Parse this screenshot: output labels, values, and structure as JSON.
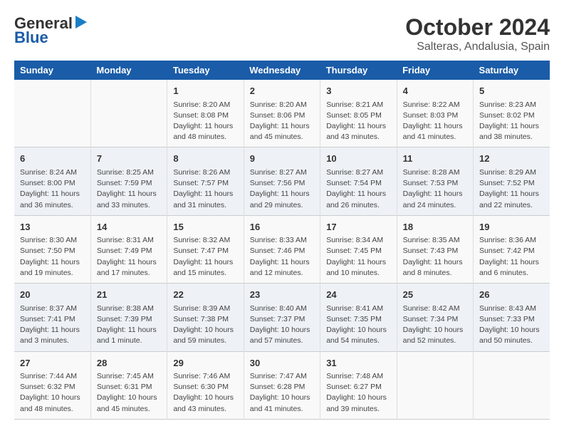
{
  "header": {
    "logo_line1": "General",
    "logo_line2": "Blue",
    "title": "October 2024",
    "subtitle": "Salteras, Andalusia, Spain"
  },
  "calendar": {
    "days_of_week": [
      "Sunday",
      "Monday",
      "Tuesday",
      "Wednesday",
      "Thursday",
      "Friday",
      "Saturday"
    ],
    "weeks": [
      [
        {
          "day": "",
          "info": ""
        },
        {
          "day": "",
          "info": ""
        },
        {
          "day": "1",
          "info": "Sunrise: 8:20 AM\nSunset: 8:08 PM\nDaylight: 11 hours and 48 minutes."
        },
        {
          "day": "2",
          "info": "Sunrise: 8:20 AM\nSunset: 8:06 PM\nDaylight: 11 hours and 45 minutes."
        },
        {
          "day": "3",
          "info": "Sunrise: 8:21 AM\nSunset: 8:05 PM\nDaylight: 11 hours and 43 minutes."
        },
        {
          "day": "4",
          "info": "Sunrise: 8:22 AM\nSunset: 8:03 PM\nDaylight: 11 hours and 41 minutes."
        },
        {
          "day": "5",
          "info": "Sunrise: 8:23 AM\nSunset: 8:02 PM\nDaylight: 11 hours and 38 minutes."
        }
      ],
      [
        {
          "day": "6",
          "info": "Sunrise: 8:24 AM\nSunset: 8:00 PM\nDaylight: 11 hours and 36 minutes."
        },
        {
          "day": "7",
          "info": "Sunrise: 8:25 AM\nSunset: 7:59 PM\nDaylight: 11 hours and 33 minutes."
        },
        {
          "day": "8",
          "info": "Sunrise: 8:26 AM\nSunset: 7:57 PM\nDaylight: 11 hours and 31 minutes."
        },
        {
          "day": "9",
          "info": "Sunrise: 8:27 AM\nSunset: 7:56 PM\nDaylight: 11 hours and 29 minutes."
        },
        {
          "day": "10",
          "info": "Sunrise: 8:27 AM\nSunset: 7:54 PM\nDaylight: 11 hours and 26 minutes."
        },
        {
          "day": "11",
          "info": "Sunrise: 8:28 AM\nSunset: 7:53 PM\nDaylight: 11 hours and 24 minutes."
        },
        {
          "day": "12",
          "info": "Sunrise: 8:29 AM\nSunset: 7:52 PM\nDaylight: 11 hours and 22 minutes."
        }
      ],
      [
        {
          "day": "13",
          "info": "Sunrise: 8:30 AM\nSunset: 7:50 PM\nDaylight: 11 hours and 19 minutes."
        },
        {
          "day": "14",
          "info": "Sunrise: 8:31 AM\nSunset: 7:49 PM\nDaylight: 11 hours and 17 minutes."
        },
        {
          "day": "15",
          "info": "Sunrise: 8:32 AM\nSunset: 7:47 PM\nDaylight: 11 hours and 15 minutes."
        },
        {
          "day": "16",
          "info": "Sunrise: 8:33 AM\nSunset: 7:46 PM\nDaylight: 11 hours and 12 minutes."
        },
        {
          "day": "17",
          "info": "Sunrise: 8:34 AM\nSunset: 7:45 PM\nDaylight: 11 hours and 10 minutes."
        },
        {
          "day": "18",
          "info": "Sunrise: 8:35 AM\nSunset: 7:43 PM\nDaylight: 11 hours and 8 minutes."
        },
        {
          "day": "19",
          "info": "Sunrise: 8:36 AM\nSunset: 7:42 PM\nDaylight: 11 hours and 6 minutes."
        }
      ],
      [
        {
          "day": "20",
          "info": "Sunrise: 8:37 AM\nSunset: 7:41 PM\nDaylight: 11 hours and 3 minutes."
        },
        {
          "day": "21",
          "info": "Sunrise: 8:38 AM\nSunset: 7:39 PM\nDaylight: 11 hours and 1 minute."
        },
        {
          "day": "22",
          "info": "Sunrise: 8:39 AM\nSunset: 7:38 PM\nDaylight: 10 hours and 59 minutes."
        },
        {
          "day": "23",
          "info": "Sunrise: 8:40 AM\nSunset: 7:37 PM\nDaylight: 10 hours and 57 minutes."
        },
        {
          "day": "24",
          "info": "Sunrise: 8:41 AM\nSunset: 7:35 PM\nDaylight: 10 hours and 54 minutes."
        },
        {
          "day": "25",
          "info": "Sunrise: 8:42 AM\nSunset: 7:34 PM\nDaylight: 10 hours and 52 minutes."
        },
        {
          "day": "26",
          "info": "Sunrise: 8:43 AM\nSunset: 7:33 PM\nDaylight: 10 hours and 50 minutes."
        }
      ],
      [
        {
          "day": "27",
          "info": "Sunrise: 7:44 AM\nSunset: 6:32 PM\nDaylight: 10 hours and 48 minutes."
        },
        {
          "day": "28",
          "info": "Sunrise: 7:45 AM\nSunset: 6:31 PM\nDaylight: 10 hours and 45 minutes."
        },
        {
          "day": "29",
          "info": "Sunrise: 7:46 AM\nSunset: 6:30 PM\nDaylight: 10 hours and 43 minutes."
        },
        {
          "day": "30",
          "info": "Sunrise: 7:47 AM\nSunset: 6:28 PM\nDaylight: 10 hours and 41 minutes."
        },
        {
          "day": "31",
          "info": "Sunrise: 7:48 AM\nSunset: 6:27 PM\nDaylight: 10 hours and 39 minutes."
        },
        {
          "day": "",
          "info": ""
        },
        {
          "day": "",
          "info": ""
        }
      ]
    ]
  }
}
